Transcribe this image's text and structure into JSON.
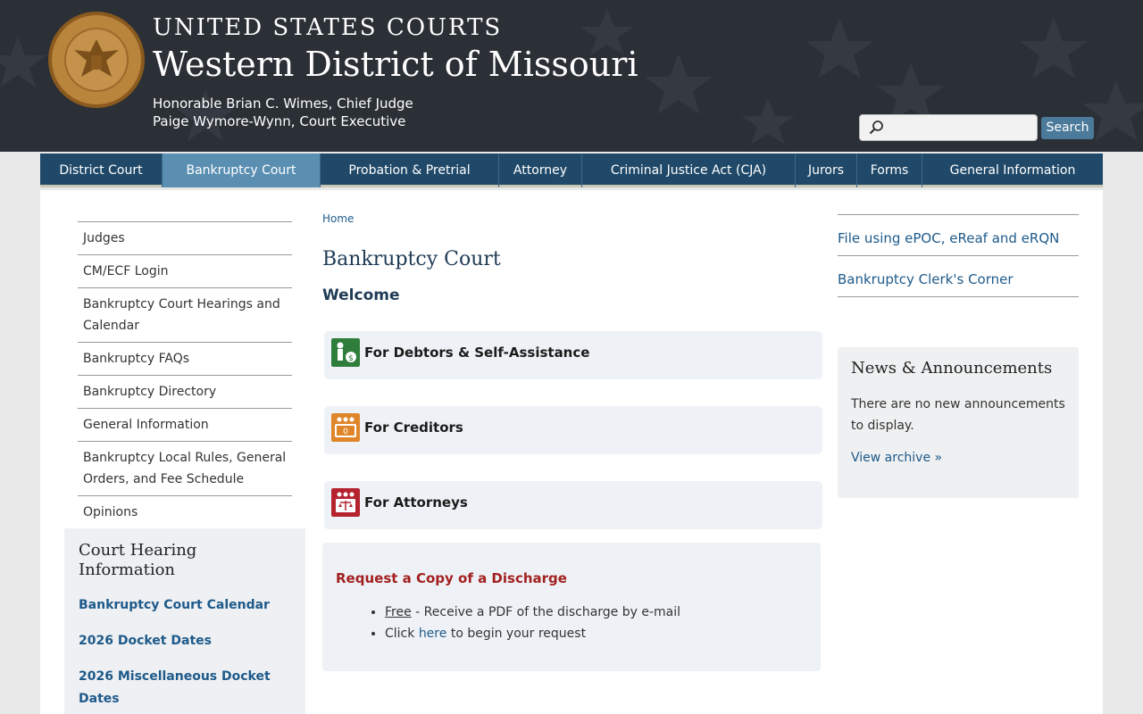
{
  "header": {
    "line1": "UNITED STATES COURTS",
    "line2": "Western District of Missouri",
    "judge": "Honorable Brian C. Wimes, Chief Judge",
    "executive": "Paige Wymore-Wynn, Court Executive",
    "seal_text_top": "UNITED STATES COURTS",
    "seal_text_bottom": "WESTERN DISTRICT OF MISSOURI"
  },
  "search": {
    "value": "",
    "button_label": "Search"
  },
  "nav": {
    "items": [
      {
        "label": "District Court"
      },
      {
        "label": "Bankruptcy Court"
      },
      {
        "label": "Probation & Pretrial"
      },
      {
        "label": "Attorney"
      },
      {
        "label": "Criminal Justice Act (CJA)"
      },
      {
        "label": "Jurors"
      },
      {
        "label": "Forms"
      },
      {
        "label": "General Information"
      }
    ]
  },
  "sidebar": {
    "items": [
      {
        "label": "Judges"
      },
      {
        "label": "CM/ECF Login"
      },
      {
        "label": "Bankruptcy Court Hearings and Calendar"
      },
      {
        "label": "Bankruptcy FAQs"
      },
      {
        "label": "Bankruptcy Directory"
      },
      {
        "label": "General Information"
      },
      {
        "label": "Bankruptcy Local Rules, General Orders, and Fee Schedule"
      },
      {
        "label": "Opinions"
      }
    ]
  },
  "hearing": {
    "title": "Court Hearing Information",
    "links": [
      {
        "label": "Bankruptcy Court Calendar"
      },
      {
        "label": "2026 Docket Dates"
      },
      {
        "label": "2026 Miscellaneous Docket Dates"
      }
    ]
  },
  "main": {
    "breadcrumb": "Home",
    "title": "Bankruptcy Court",
    "welcome": "Welcome",
    "cards": [
      {
        "label": "For Debtors & Self-Assistance",
        "color": "#2e7d3a"
      },
      {
        "label": "For Creditors",
        "color": "#e0862a"
      },
      {
        "label": "For Attorneys",
        "color": "#b5232f"
      }
    ],
    "discharge": {
      "title": "Request a Copy of a Discharge",
      "item1_free": "Free",
      "item1_rest": " - Receive a PDF of the discharge by e-mail",
      "item2_pre": "Click ",
      "item2_link": "here",
      "item2_post": " to begin your request"
    }
  },
  "right": {
    "links": [
      {
        "label": "File using ePOC, eReaf and eRQN"
      },
      {
        "label": "Bankruptcy Clerk's Corner"
      }
    ],
    "news": {
      "title": "News & Announcements",
      "text": "There are no new announcements to display.",
      "link": "View archive »"
    }
  }
}
